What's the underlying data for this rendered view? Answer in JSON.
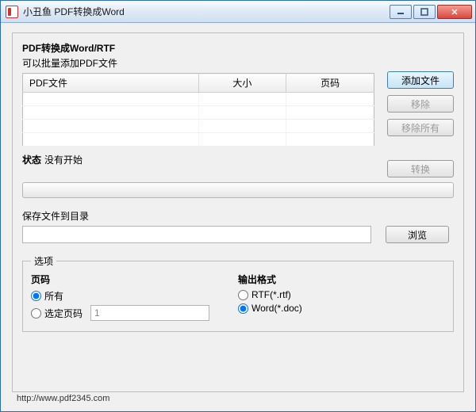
{
  "window": {
    "title": "小丑鱼 PDF转换成Word"
  },
  "panel": {
    "heading": "PDF转换成Word/RTF",
    "subtext": "可以批量添加PDF文件"
  },
  "table": {
    "columns": {
      "file": "PDF文件",
      "size": "大小",
      "pages": "页码"
    }
  },
  "buttons": {
    "add": "添加文件",
    "remove": "移除",
    "remove_all": "移除所有",
    "convert": "转换",
    "browse": "浏览"
  },
  "status": {
    "label": "状态",
    "value": "没有开始"
  },
  "save": {
    "label": "保存文件到目录",
    "path": ""
  },
  "options": {
    "legend": "选项",
    "pages": {
      "heading": "页码",
      "all": "所有",
      "selected": "选定页码",
      "selected_value": "1"
    },
    "output": {
      "heading": "输出格式",
      "rtf": "RTF(*.rtf)",
      "word": "Word(*.doc)"
    }
  },
  "footer": {
    "url": "http://www.pdf2345.com"
  }
}
